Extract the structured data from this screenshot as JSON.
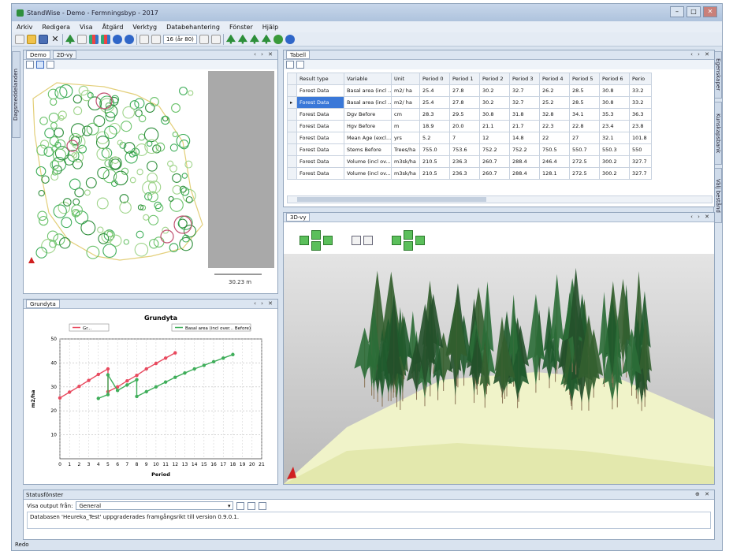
{
  "window": {
    "title": "StandWise - Demo - Fermningsbyp - 2017",
    "controls": {
      "minimize": "–",
      "maximize": "□",
      "close": "✕"
    }
  },
  "menu": [
    "Arkiv",
    "Redigera",
    "Visa",
    "Åtgärd",
    "Verktyg",
    "Databehantering",
    "Fönster",
    "Hjälp"
  ],
  "toolbar": {
    "zoom_text": "16 (år 80)"
  },
  "left_sidebar": {
    "tab_label": "Dagsmeddelanden"
  },
  "right_sidebar": {
    "tab1": "Egenskaper",
    "tab2": "Kunskapsbank",
    "tab3": "Välj bestånd"
  },
  "map_panel": {
    "tabs": [
      "Demo",
      "2D-vy"
    ],
    "scale_label": "30.23 m"
  },
  "table_panel": {
    "tab": "Tabell",
    "columns": [
      "Result type",
      "Variable",
      "Unit",
      "Period 0",
      "Period 1",
      "Period 2",
      "Period 3",
      "Period 4",
      "Period 5",
      "Period 6",
      "Perio"
    ],
    "rows": [
      [
        "Forest Data",
        "Basal area (incl ...",
        "m2/ ha",
        "25.4",
        "27.8",
        "30.2",
        "32.7",
        "26.2",
        "28.5",
        "30.8",
        "33.2"
      ],
      [
        "Forest Data",
        "Basal area (incl ...",
        "m2/ ha",
        "25.4",
        "27.8",
        "30.2",
        "32.7",
        "25.2",
        "28.5",
        "30.8",
        "33.2"
      ],
      [
        "Forest Data",
        "Dgv Before",
        "cm",
        "28.3",
        "29.5",
        "30.8",
        "31.8",
        "32.8",
        "34.1",
        "35.3",
        "36.3"
      ],
      [
        "Forest Data",
        "Hgv Before",
        "m",
        "18.9",
        "20.0",
        "21.1",
        "21.7",
        "22.3",
        "22.8",
        "23.4",
        "23.8"
      ],
      [
        "Forest Data",
        "Mean Age (excl...",
        "yrs",
        "5.2",
        "7",
        "12",
        "14.8",
        "22",
        "27",
        "32.1",
        "101.8"
      ],
      [
        "Forest Data",
        "Stems Before",
        "Trees/ha",
        "755.0",
        "753.6",
        "752.2",
        "752.2",
        "750.5",
        "550.7",
        "550.3",
        "550"
      ],
      [
        "Forest Data",
        "Volume (incl ov...",
        "m3sk/ha",
        "210.5",
        "236.3",
        "260.7",
        "288.4",
        "246.4",
        "272.5",
        "300.2",
        "327.7"
      ],
      [
        "Forest Data",
        "Volume (incl ov...",
        "m3sk/ha",
        "210.5",
        "236.3",
        "260.7",
        "288.4",
        "128.1",
        "272.5",
        "300.2",
        "327.7"
      ]
    ]
  },
  "view3d_panel": {
    "tab": "3D-vy"
  },
  "chart_panel": {
    "tab": "Grundyta",
    "legend": [
      "Gr...",
      "Basal area (incl over... Before)"
    ]
  },
  "chart_data": {
    "type": "line",
    "title": "Grundyta",
    "xlabel": "Period",
    "ylabel": "m2/ha",
    "xlim": [
      0,
      21
    ],
    "ylim": [
      0,
      50
    ],
    "xticks": [
      0,
      1,
      2,
      3,
      4,
      5,
      6,
      7,
      8,
      9,
      10,
      11,
      12,
      13,
      14,
      15,
      16,
      17,
      18,
      19,
      20,
      21
    ],
    "yticks": [
      10,
      20,
      30,
      40,
      50
    ],
    "grid": true,
    "legend_position": "top",
    "series": [
      {
        "name": "Gr...",
        "color": "#e84a5f",
        "x": [
          0,
          1,
          2,
          3,
          4,
          5,
          5,
          6,
          7,
          8,
          9,
          10,
          11,
          12
        ],
        "y": [
          25.4,
          27.8,
          30.2,
          32.7,
          35.2,
          37.5,
          28.0,
          30.0,
          32.5,
          34.8,
          37.5,
          39.8,
          42.0,
          44.2
        ]
      },
      {
        "name": "Basal area (incl over... Before)",
        "color": "#3fae5a",
        "x": [
          4,
          5,
          5,
          6,
          7,
          8,
          8,
          9,
          10,
          11,
          12,
          13,
          14,
          15,
          16,
          17,
          18
        ],
        "y": [
          25.2,
          26.8,
          35.0,
          28.5,
          30.8,
          33.0,
          26.0,
          28.0,
          30.0,
          32.0,
          34.0,
          35.8,
          37.5,
          39.0,
          40.5,
          42.0,
          43.5
        ]
      }
    ]
  },
  "status_panel": {
    "title": "Statusfönster",
    "label": "Visa output från:",
    "source": "General",
    "message": "Databasen 'Heureka_Test' uppgraderades framgångsrikt till version 0.9.0.1."
  },
  "app_status": "Redo",
  "colors": {
    "tree_green": "#2f8f3c",
    "table_selected": "#3a78d8",
    "terrain": "#eef2c8"
  }
}
